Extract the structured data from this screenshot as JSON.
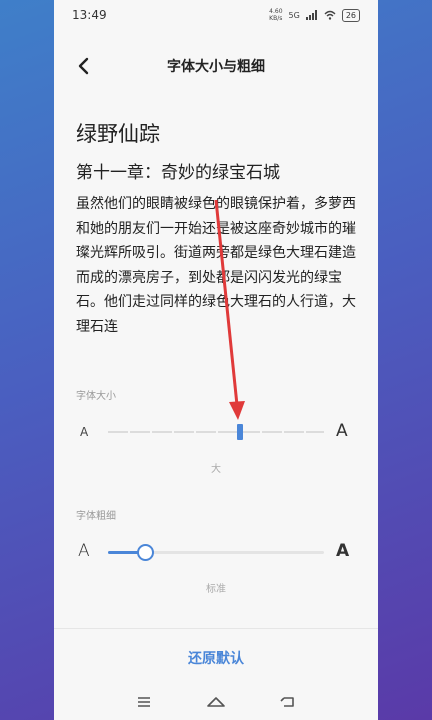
{
  "status_bar": {
    "time": "13:49",
    "network": "4.60\nKB/s",
    "signal": "5G",
    "battery": "26"
  },
  "header": {
    "title": "字体大小与粗细"
  },
  "preview": {
    "book_title": "绿野仙踪",
    "chapter_title": "第十一章：奇妙的绿宝石城",
    "text": "虽然他们的眼睛被绿色的眼镜保护着，多萝西和她的朋友们一开始还是被这座奇妙城市的璀璨光辉所吸引。街道两旁都是绿色大理石建造而成的漂亮房子，到处都是闪闪发光的绿宝石。他们走过同样的绿色大理石的人行道，大理石连"
  },
  "font_size": {
    "label": "字体大小",
    "small_glyph": "A",
    "large_glyph": "A",
    "value": "大",
    "level": 0.61
  },
  "font_weight": {
    "label": "字体粗细",
    "small_glyph": "A",
    "large_glyph": "A",
    "value": "标准",
    "level": 0.17
  },
  "reset_button": {
    "label": "还原默认"
  },
  "colors": {
    "accent": "#4a86d8",
    "arrow": "#e03a3a"
  },
  "nav_icons": [
    "menu-icon",
    "home-icon",
    "back-icon"
  ]
}
